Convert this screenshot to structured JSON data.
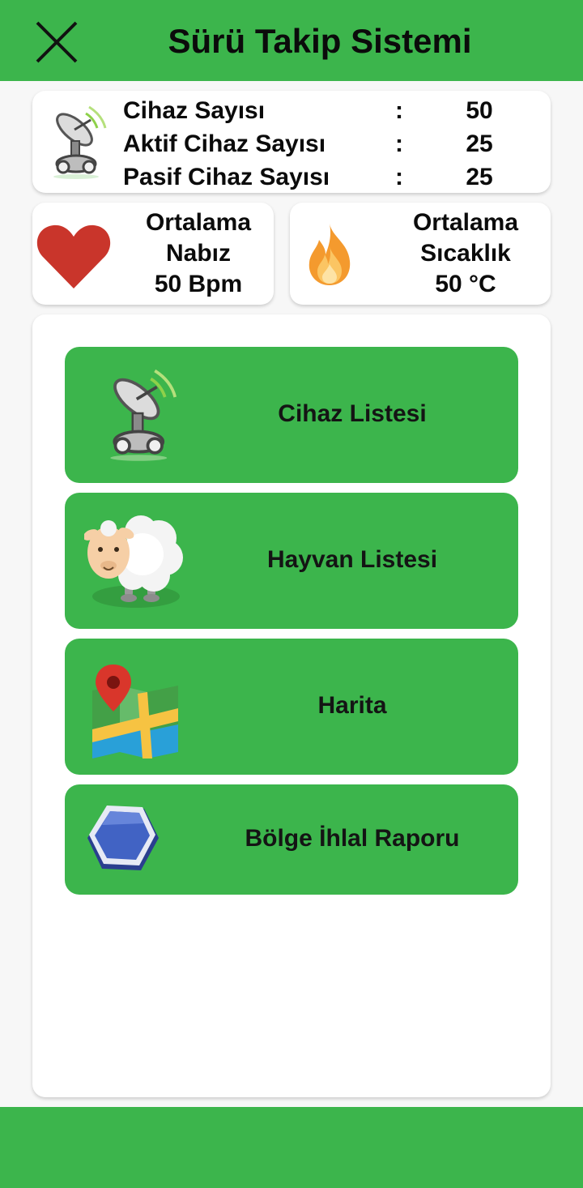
{
  "header": {
    "title": "Sürü Takip Sistemi",
    "close_icon": "close-icon"
  },
  "devices": {
    "icon": "satellite-dish-icon",
    "rows": [
      {
        "label": "Cihaz Sayısı",
        "separator": ":",
        "value": "50"
      },
      {
        "label": "Aktif Cihaz Sayısı",
        "separator": ":",
        "value": "25"
      },
      {
        "label": "Pasif Cihaz Sayısı",
        "separator": ":",
        "value": "25"
      }
    ]
  },
  "pulse": {
    "icon": "heart-icon",
    "line1": "Ortalama",
    "line2": "Nabız",
    "value": "50 Bpm"
  },
  "temperature": {
    "icon": "flame-icon",
    "line1": "Ortalama",
    "line2": "Sıcaklık",
    "value": "50 °C"
  },
  "menu": {
    "items": [
      {
        "label": "Cihaz Listesi",
        "icon": "satellite-dish-icon"
      },
      {
        "label": "Hayvan Listesi",
        "icon": "sheep-icon"
      },
      {
        "label": "Harita",
        "icon": "map-icon"
      },
      {
        "label": "Bölge İhlal Raporu",
        "icon": "hexagon-icon"
      }
    ]
  },
  "colors": {
    "primary_green": "#3cb54c",
    "card_bg": "#ffffff",
    "page_bg": "#f7f7f7",
    "heart_red": "#c9352b",
    "flame_orange": "#f6a03a"
  }
}
